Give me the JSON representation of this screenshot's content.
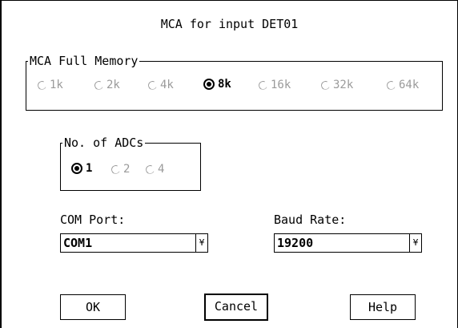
{
  "dialog": {
    "title": "MCA for input DET01",
    "memory": {
      "legend": "MCA Full Memory",
      "options": [
        "1k",
        "2k",
        "4k",
        "8k",
        "16k",
        "32k",
        "64k"
      ],
      "selected": "8k"
    },
    "adcs": {
      "legend": "No. of ADCs",
      "options": [
        "1",
        "2",
        "4"
      ],
      "selected": "1"
    },
    "com_port": {
      "label": "COM Port:",
      "value": "COM1",
      "arrow": "¥"
    },
    "baud_rate": {
      "label": "Baud Rate:",
      "value": "19200",
      "arrow": "¥"
    },
    "buttons": {
      "ok": "OK",
      "cancel": "Cancel",
      "help": "Help"
    }
  }
}
